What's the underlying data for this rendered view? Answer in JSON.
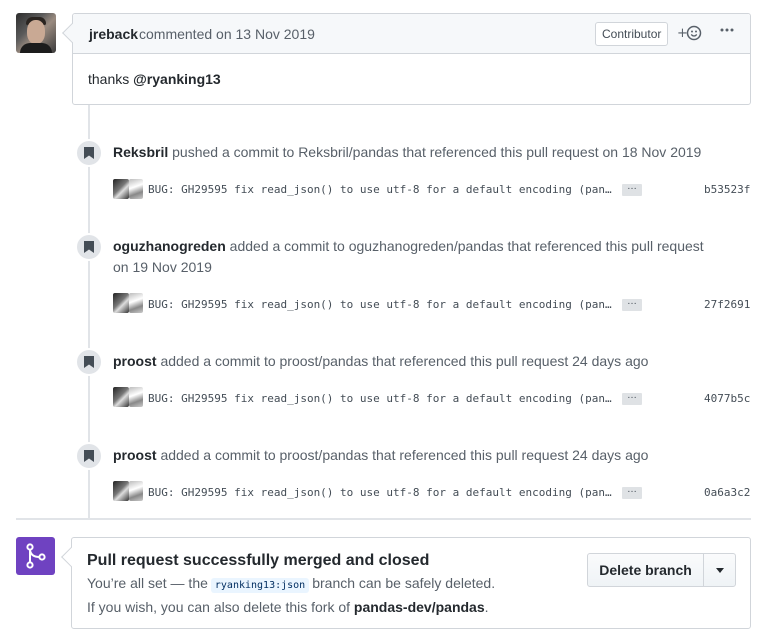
{
  "comment": {
    "author": "jreback",
    "meta": "commented on 13 Nov 2019",
    "badge": "Contributor",
    "reaction_icon": "smiley-add-icon",
    "more_icon": "kebab-horizontal-icon",
    "body_prefix": "thanks ",
    "body_mention": "@ryanking13"
  },
  "events": [
    {
      "actor": "Reksbril",
      "text": " pushed a commit to Reksbril/pandas that referenced this pull request on 18 Nov 2019",
      "commit_message": "BUG: GH29595 fix read_json() to use utf-8 for a default encoding (pan…",
      "expand": "…",
      "sha": "b53523f"
    },
    {
      "actor": "oguzhanogreden",
      "text": " added a commit to oguzhanogreden/pandas that referenced this pull request on 19 Nov 2019",
      "commit_message": "BUG: GH29595 fix read_json() to use utf-8 for a default encoding (pan…",
      "expand": "…",
      "sha": "27f2691"
    },
    {
      "actor": "proost",
      "text": " added a commit to proost/pandas that referenced this pull request 24 days ago",
      "commit_message": "BUG: GH29595 fix read_json() to use utf-8 for a default encoding (pan…",
      "expand": "…",
      "sha": "4077b5c"
    },
    {
      "actor": "proost",
      "text": " added a commit to proost/pandas that referenced this pull request 24 days ago",
      "commit_message": "BUG: GH29595 fix read_json() to use utf-8 for a default encoding (pan…",
      "expand": "…",
      "sha": "0a6a3c2"
    }
  ],
  "merge": {
    "title": "Pull request successfully merged and closed",
    "line1_before": "You’re all set — the",
    "branch": "ryanking13:json",
    "line1_after": "branch can be safely deleted.",
    "line2_before": "If you wish, you can also delete this fork of ",
    "line2_repo": "pandas-dev/pandas",
    "line2_after": ".",
    "delete_label": "Delete branch"
  },
  "colors": {
    "merged_purple": "#6f42c1",
    "timeline_gray": "#e1e4e8"
  }
}
